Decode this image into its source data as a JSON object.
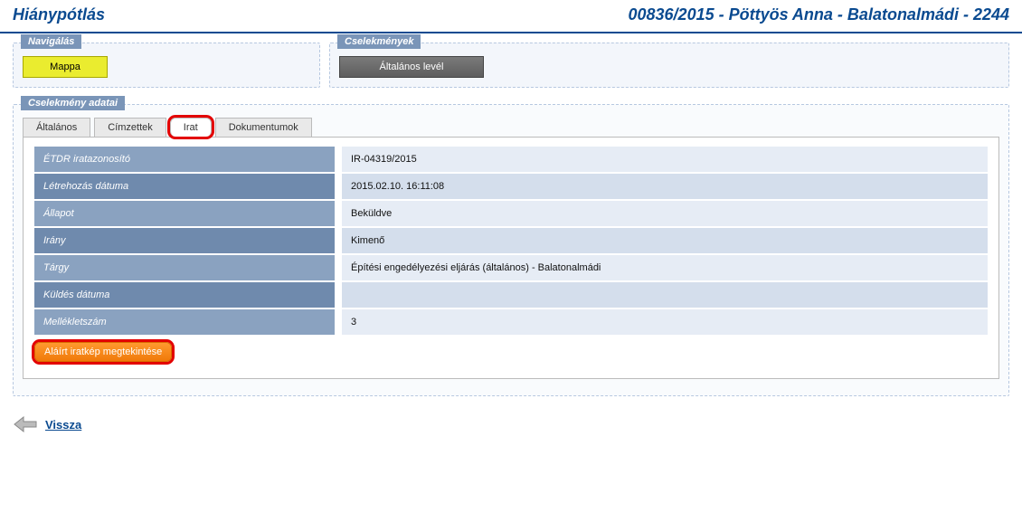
{
  "header": {
    "title": "Hiánypótlás",
    "context": "00836/2015 - Pöttyös Anna - Balatonalmádi - 2244"
  },
  "nav_panel": {
    "label": "Navigálás",
    "mappa_btn": "Mappa"
  },
  "actions_panel": {
    "label": "Cselekmények",
    "general_letter_btn": "Általános levél"
  },
  "main": {
    "label": "Cselekmény adatai",
    "tabs": {
      "t0": "Általános",
      "t1": "Címzettek",
      "t2": "Irat",
      "t3": "Dokumentumok"
    },
    "rows": {
      "r0": {
        "k": "ÉTDR iratazonosító",
        "v": "IR-04319/2015"
      },
      "r1": {
        "k": "Létrehozás dátuma",
        "v": "2015.02.10. 16:11:08"
      },
      "r2": {
        "k": "Állapot",
        "v": "Beküldve"
      },
      "r3": {
        "k": "Irány",
        "v": "Kimenő"
      },
      "r4": {
        "k": "Tárgy",
        "v": "Építési engedélyezési eljárás (általános) - Balatonalmádi"
      },
      "r5": {
        "k": "Küldés dátuma",
        "v": ""
      },
      "r6": {
        "k": "Mellékletszám",
        "v": "3"
      }
    },
    "view_signed_btn": "Aláírt iratkép megtekintése"
  },
  "back_link": "Vissza"
}
